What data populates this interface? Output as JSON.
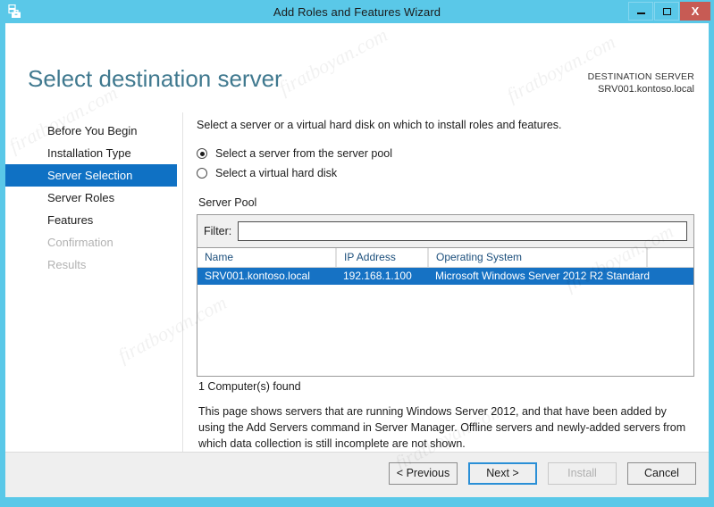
{
  "window": {
    "title": "Add Roles and Features Wizard",
    "icon": "server-toolbox-icon",
    "controls": {
      "minimize": "minimize-icon",
      "maximize": "maximize-icon",
      "close": "X"
    },
    "accent_color": "#5ac8e8"
  },
  "header": {
    "page_title": "Select destination server",
    "destination_label": "DESTINATION SERVER",
    "destination_value": "SRV001.kontoso.local",
    "title_color": "#40798f"
  },
  "sidebar": {
    "items": [
      {
        "label": "Before You Begin",
        "state": "normal"
      },
      {
        "label": "Installation Type",
        "state": "normal"
      },
      {
        "label": "Server Selection",
        "state": "active"
      },
      {
        "label": "Server Roles",
        "state": "normal"
      },
      {
        "label": "Features",
        "state": "normal"
      },
      {
        "label": "Confirmation",
        "state": "disabled"
      },
      {
        "label": "Results",
        "state": "disabled"
      }
    ],
    "active_color": "#0f71c4"
  },
  "main": {
    "intro": "Select a server or a virtual hard disk on which to install roles and features.",
    "options": [
      {
        "label": "Select a server from the server pool",
        "checked": true
      },
      {
        "label": "Select a virtual hard disk",
        "checked": false
      }
    ],
    "pool_section_title": "Server Pool",
    "filter": {
      "label": "Filter:",
      "value": "",
      "placeholder": ""
    },
    "table": {
      "columns": [
        "Name",
        "IP Address",
        "Operating System",
        ""
      ],
      "rows": [
        {
          "name": "SRV001.kontoso.local",
          "ip": "192.168.1.100",
          "os": "Microsoft Windows Server 2012 R2 Standard",
          "selected": true
        }
      ],
      "selection_color": "#1672c4",
      "header_color": "#1c4f7c"
    },
    "found_text": "1 Computer(s) found",
    "note": "This page shows servers that are running Windows Server 2012, and that have been added by using the Add Servers command in Server Manager. Offline servers and newly-added servers from which data collection is still incomplete are not shown."
  },
  "footer": {
    "buttons": [
      {
        "label": "< Previous",
        "state": "normal"
      },
      {
        "label": "Next >",
        "state": "focused"
      },
      {
        "label": "Install",
        "state": "disabled"
      },
      {
        "label": "Cancel",
        "state": "normal"
      }
    ]
  },
  "watermarks": [
    "firatboyan.com",
    "firatboyan.com",
    "firatboyan.com",
    "firatboyan.com",
    "firatboyan.com",
    "firatboyan.com"
  ]
}
